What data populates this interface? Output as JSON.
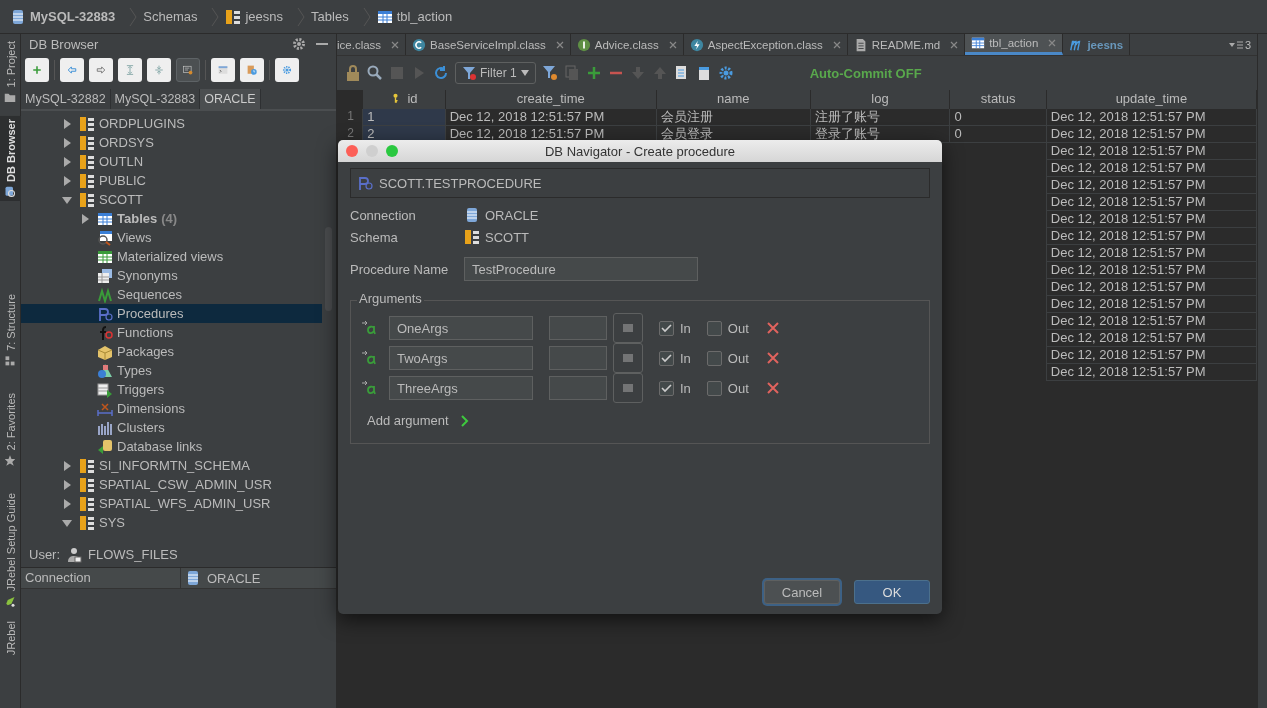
{
  "breadcrumb": [
    {
      "label": "MySQL-32883",
      "kind": "connection"
    },
    {
      "label": "Schemas",
      "kind": "none"
    },
    {
      "label": "jeesns",
      "kind": "schema"
    },
    {
      "label": "Tables",
      "kind": "none"
    },
    {
      "label": "tbl_action",
      "kind": "table"
    }
  ],
  "side_tabs": [
    {
      "label": "1: Project",
      "kind": "folder",
      "selected": false
    },
    {
      "label": "DB Browser",
      "kind": "db",
      "selected": true
    },
    {
      "label": "7: Structure",
      "kind": "structure",
      "selected": false
    },
    {
      "label": "2: Favorites",
      "kind": "star",
      "selected": false
    },
    {
      "label": "JRebel Setup Guide",
      "kind": "rocket",
      "selected": false
    },
    {
      "label": "JRebel",
      "kind": "none",
      "selected": false
    }
  ],
  "db_browser": {
    "title": "DB Browser",
    "toolbar": [
      {
        "kind": "add",
        "on": false
      },
      {
        "kind": "back",
        "on": false
      },
      {
        "kind": "forward",
        "on": false
      },
      {
        "kind": "expand",
        "on": false
      },
      {
        "kind": "collapse",
        "on": false
      },
      {
        "kind": "filter-objects",
        "on": true
      },
      {
        "kind": "console",
        "on": false
      },
      {
        "kind": "history",
        "on": false
      },
      {
        "kind": "settings",
        "on": false
      }
    ],
    "connections": [
      {
        "label": "MySQL-32882",
        "selected": false
      },
      {
        "label": "MySQL-32883",
        "selected": false
      },
      {
        "label": "ORACLE",
        "selected": true
      }
    ],
    "tree": [
      {
        "label": "ORDPLUGINS",
        "kind": "schema",
        "expanded": false,
        "selected": false
      },
      {
        "label": "ORDSYS",
        "kind": "schema",
        "expanded": false,
        "selected": false
      },
      {
        "label": "OUTLN",
        "kind": "schema",
        "expanded": false,
        "selected": false
      },
      {
        "label": "PUBLIC",
        "kind": "schema",
        "expanded": false,
        "selected": false
      },
      {
        "label": "SCOTT",
        "kind": "schema",
        "expanded": true,
        "selected": false,
        "children": [
          {
            "label": "Tables",
            "count": "(4)",
            "kind": "tables",
            "expanded": false,
            "selected": false
          },
          {
            "label": "Views",
            "kind": "views",
            "selected": false
          },
          {
            "label": "Materialized views",
            "kind": "mviews",
            "selected": false
          },
          {
            "label": "Synonyms",
            "kind": "synonyms",
            "selected": false
          },
          {
            "label": "Sequences",
            "kind": "sequences",
            "selected": false
          },
          {
            "label": "Procedures",
            "kind": "procedures",
            "selected": true
          },
          {
            "label": "Functions",
            "kind": "functions",
            "selected": false
          },
          {
            "label": "Packages",
            "kind": "packages",
            "selected": false
          },
          {
            "label": "Types",
            "kind": "types",
            "selected": false
          },
          {
            "label": "Triggers",
            "kind": "triggers",
            "selected": false
          },
          {
            "label": "Dimensions",
            "kind": "dimensions",
            "selected": false
          },
          {
            "label": "Clusters",
            "kind": "clusters",
            "selected": false
          },
          {
            "label": "Database links",
            "kind": "dblinks",
            "selected": false
          }
        ]
      },
      {
        "label": "SI_INFORMTN_SCHEMA",
        "kind": "schema",
        "expanded": false,
        "selected": false
      },
      {
        "label": "SPATIAL_CSW_ADMIN_USR",
        "kind": "schema",
        "expanded": false,
        "selected": false
      },
      {
        "label": "SPATIAL_WFS_ADMIN_USR",
        "kind": "schema",
        "expanded": false,
        "selected": false
      },
      {
        "label": "SYS",
        "kind": "schema",
        "expanded": true,
        "selected": false
      }
    ],
    "user_label": "User:",
    "user": "FLOWS_FILES",
    "properties": [
      {
        "name": "Connection",
        "value": "ORACLE"
      }
    ]
  },
  "editor_tabs": [
    {
      "label": "ice.class",
      "kind": "clipped",
      "selected": false
    },
    {
      "label": "BaseServiceImpl.class",
      "kind": "class",
      "selected": false
    },
    {
      "label": "Advice.class",
      "kind": "interface",
      "selected": false
    },
    {
      "label": "AspectException.class",
      "kind": "exception",
      "selected": false
    },
    {
      "label": "README.md",
      "kind": "text",
      "selected": false
    },
    {
      "label": "tbl_action",
      "kind": "table",
      "selected": true
    },
    {
      "label": "jeesns",
      "kind": "module",
      "selected": false
    }
  ],
  "tab_overflow": "3",
  "editor_toolbar": {
    "filter": "Filter 1",
    "auto_commit": "Auto-Commit OFF"
  },
  "table": {
    "columns": [
      {
        "label": "id",
        "kind": "key"
      },
      {
        "label": "create_time",
        "kind": "plain"
      },
      {
        "label": "name",
        "kind": "plain"
      },
      {
        "label": "log",
        "kind": "plain"
      },
      {
        "label": "status",
        "kind": "plain"
      },
      {
        "label": "update_time",
        "kind": "plain"
      }
    ],
    "rows": [
      {
        "number": "1",
        "cells": [
          "1",
          "Dec 12, 2018 12:51:57 PM",
          "会员注册",
          "注册了账号",
          "0",
          "Dec 12, 2018 12:51:57 PM"
        ]
      },
      {
        "number": "2",
        "cells": [
          "2",
          "Dec 12, 2018 12:51:57 PM",
          "会员登录",
          "登录了账号",
          "0",
          "Dec 12, 2018 12:51:57 PM"
        ]
      },
      {
        "update_time": "Dec 12, 2018 12:51:57 PM"
      },
      {
        "update_time": "Dec 12, 2018 12:51:57 PM"
      },
      {
        "update_time": "Dec 12, 2018 12:51:57 PM"
      },
      {
        "update_time": "Dec 12, 2018 12:51:57 PM"
      },
      {
        "update_time": "Dec 12, 2018 12:51:57 PM"
      },
      {
        "update_time": "Dec 12, 2018 12:51:57 PM"
      },
      {
        "update_time": "Dec 12, 2018 12:51:57 PM"
      },
      {
        "update_time": "Dec 12, 2018 12:51:57 PM"
      },
      {
        "update_time": "Dec 12, 2018 12:51:57 PM"
      },
      {
        "update_time": "Dec 12, 2018 12:51:57 PM"
      },
      {
        "update_time": "Dec 12, 2018 12:51:57 PM"
      },
      {
        "update_time": "Dec 12, 2018 12:51:57 PM"
      },
      {
        "update_time": "Dec 12, 2018 12:51:57 PM"
      },
      {
        "update_time": "Dec 12, 2018 12:51:57 PM"
      }
    ]
  },
  "dialog": {
    "title": "DB Navigator - Create procedure",
    "object_name": "SCOTT.TESTPROCEDURE",
    "fields": [
      {
        "label": "Connection",
        "value": "ORACLE",
        "kind": "connection"
      },
      {
        "label": "Schema",
        "value": "SCOTT",
        "kind": "schema"
      }
    ],
    "name_label": "Procedure Name",
    "name_value": "TestProcedure",
    "arguments_label": "Arguments",
    "arguments": [
      {
        "name": "OneArgs",
        "in": true,
        "out": false,
        "in_label": "In",
        "out_label": "Out"
      },
      {
        "name": "TwoArgs",
        "in": true,
        "out": false,
        "in_label": "In",
        "out_label": "Out"
      },
      {
        "name": "ThreeArgs",
        "in": true,
        "out": false,
        "in_label": "In",
        "out_label": "Out"
      }
    ],
    "add_argument": "Add argument",
    "buttons": [
      {
        "label": "Cancel",
        "kind": "secondary",
        "focused": true
      },
      {
        "label": "OK",
        "kind": "primary",
        "focused": false
      }
    ]
  }
}
